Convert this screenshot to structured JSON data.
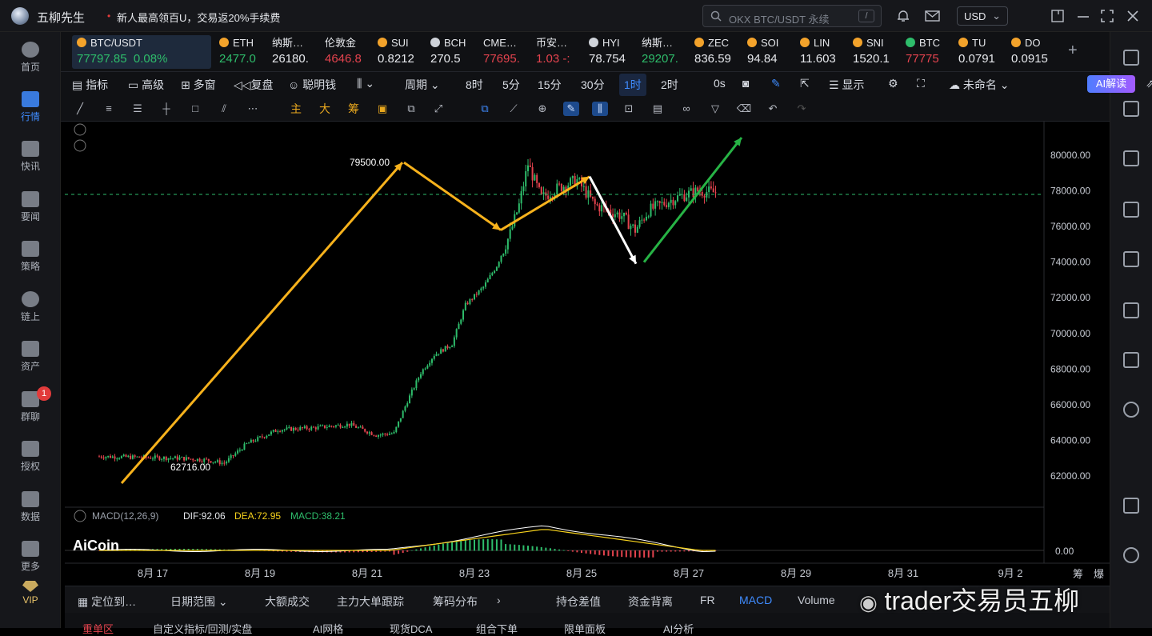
{
  "titlebar": {
    "app_name": "五柳先生",
    "promo": "新人最高领百U，交易返20%手续费",
    "search_placeholder": "OKX BTC/USDT 永续",
    "search_shortcut": "/",
    "currency": "USD"
  },
  "sidebar": {
    "items": [
      {
        "label": "首页"
      },
      {
        "label": "行情"
      },
      {
        "label": "快讯"
      },
      {
        "label": "要闻"
      },
      {
        "label": "策略"
      },
      {
        "label": "链上"
      },
      {
        "label": "资产"
      },
      {
        "label": "群聊",
        "badge": "1"
      },
      {
        "label": "授权"
      },
      {
        "label": "数据"
      },
      {
        "label": "更多"
      },
      {
        "label": "VIP"
      }
    ]
  },
  "tickers": [
    {
      "name": "BTC/USDT",
      "price": "77797.85",
      "change": "0.08%",
      "dir": "up"
    },
    {
      "name": "ETH",
      "price": "2477.0",
      "dir": "up"
    },
    {
      "name": "纳斯…",
      "price": "26180.",
      "dir": "wh"
    },
    {
      "name": "伦敦金",
      "price": "4646.8",
      "dir": "dn"
    },
    {
      "name": "SUI",
      "price": "0.8212",
      "dir": "wh"
    },
    {
      "name": "BCH",
      "price": "270.5",
      "dir": "wh"
    },
    {
      "name": "CME…",
      "price": "77695.",
      "dir": "dn"
    },
    {
      "name": "币安…",
      "price": "1.03 -:",
      "dir": "dn"
    },
    {
      "name": "HYI",
      "price": "78.754",
      "dir": "wh"
    },
    {
      "name": "纳斯…",
      "price": "29207.",
      "dir": "up"
    },
    {
      "name": "ZEC",
      "price": "836.59",
      "dir": "wh"
    },
    {
      "name": "SOI",
      "price": "94.84",
      "dir": "wh"
    },
    {
      "name": "LIN",
      "price": "11.603",
      "dir": "wh"
    },
    {
      "name": "SNI",
      "price": "1520.1",
      "dir": "wh"
    },
    {
      "name": "BTC",
      "price": "77775",
      "dir": "dn"
    },
    {
      "name": "TU",
      "price": "0.0791",
      "dir": "wh"
    },
    {
      "name": "DO",
      "price": "0.0915",
      "dir": "wh"
    }
  ],
  "toolbar1": {
    "indicators": "指标",
    "advanced": "高级",
    "multiwindow": "多窗",
    "replay": "复盘",
    "smart_money": "聪明钱",
    "period": "周期",
    "intervals": [
      "8时",
      "5分",
      "15分",
      "30分",
      "1时",
      "2时",
      "0s"
    ],
    "active_interval": "1时",
    "show": "显示",
    "unnamed": "未命名",
    "ai": "AI解读"
  },
  "toolbar2": {
    "zhu": "主",
    "da": "大",
    "chou": "筹"
  },
  "chart": {
    "symbol": "BTC/USDT",
    "interval": "1时",
    "y_ticks": [
      "80000.00",
      "78000.00",
      "76000.00",
      "74000.00",
      "72000.00",
      "70000.00",
      "68000.00",
      "66000.00",
      "64000.00",
      "62000.00"
    ],
    "x_ticks": [
      "8月 17",
      "8月 19",
      "8月 21",
      "8月 23",
      "8月 25",
      "8月 27",
      "8月 29",
      "8月 31",
      "9月 2"
    ],
    "annotation_high": "79500.00",
    "annotation_low": "62716.00",
    "current_price": 77797.85,
    "macd": {
      "label": "MACD(12,26,9)",
      "dif": "DIF:92.06",
      "dea": "DEA:72.95",
      "macd": "MACD:38.21",
      "zero": "0.00"
    },
    "logo": "AiCoin",
    "corner": [
      "筹",
      "爆"
    ],
    "colors": {
      "up": "#2ebd6b",
      "down": "#e4434e",
      "arrow": "#f7b21c",
      "forecast_down": "#ffffff",
      "forecast_up": "#27b345"
    }
  },
  "bottombar": {
    "locate": "定位到…",
    "date_range": "日期范围",
    "tabs": [
      "大额成交",
      "主力大单跟踪",
      "筹码分布",
      "持仓差值",
      "资金背离",
      "FR",
      "MACD",
      "Volume"
    ],
    "active_tab": "MACD"
  },
  "bottom2": {
    "items": [
      "重单区",
      "自定义指标/回测/实盘",
      "AI网格",
      "现货DCA",
      "组合下单",
      "限单面板",
      "AI分析"
    ]
  },
  "watermark": "trader交易员五柳"
}
